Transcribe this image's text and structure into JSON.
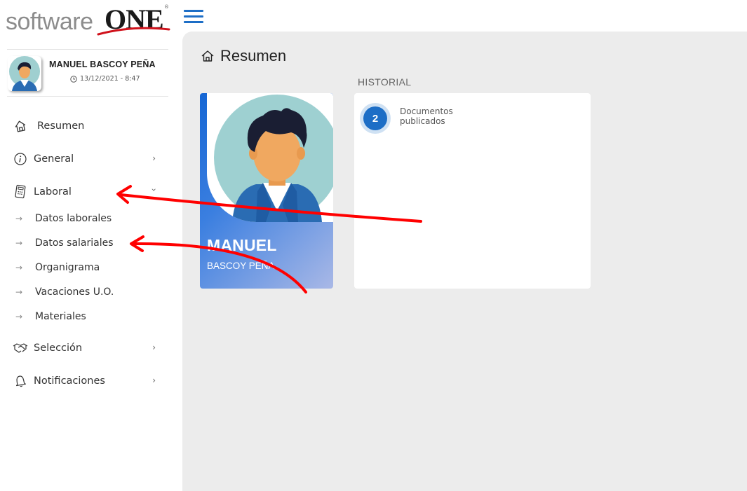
{
  "brand": {
    "logo_prefix": "software",
    "logo_suffix": "ONE",
    "logo_mark": "®",
    "accent_color": "#1d6ec6"
  },
  "user": {
    "name": "MANUEL BASCOY PEÑA",
    "datetime": "13/12/2021 - 8:47"
  },
  "sidebar": {
    "items": [
      {
        "label": "Resumen",
        "icon": "home-icon"
      },
      {
        "label": "General",
        "icon": "info-icon"
      },
      {
        "label": "Laboral",
        "icon": "calculator-icon"
      },
      {
        "label": "Selección",
        "icon": "handshake-icon"
      },
      {
        "label": "Notificaciones",
        "icon": "bell-icon"
      }
    ],
    "laboral_subitems": [
      "Datos laborales",
      "Datos salariales",
      "Organigrama",
      "Vacaciones U.O.",
      "Materiales"
    ]
  },
  "main": {
    "page_title": "Resumen",
    "profile_card": {
      "first_name": "MANUEL",
      "last_name": "BASCOY PEÑA"
    },
    "historial": {
      "label": "HISTORIAL",
      "count": "2",
      "text_line1": "Documentos",
      "text_line2": "publicados"
    }
  },
  "annotation_color": "#ff0000"
}
